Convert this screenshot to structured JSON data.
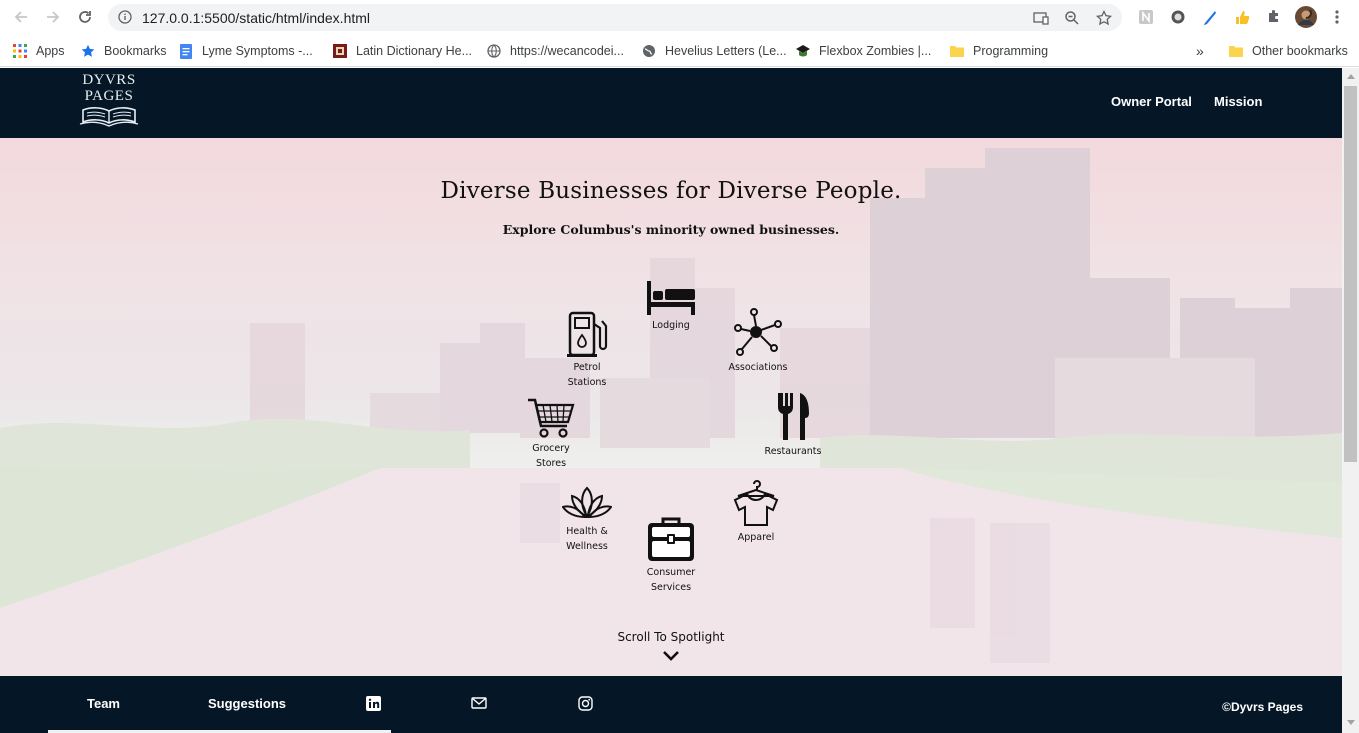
{
  "browser": {
    "url": "127.0.0.1:5500/static/html/index.html",
    "bookmarks": [
      {
        "label": "Apps",
        "icon": "apps-grid-icon"
      },
      {
        "label": "Bookmarks",
        "icon": "star-icon"
      },
      {
        "label": "Lyme Symptoms -...",
        "icon": "docs-icon"
      },
      {
        "label": "Latin Dictionary He...",
        "icon": "latin-dict-icon"
      },
      {
        "label": "https://wecancodei...",
        "icon": "globe-icon"
      },
      {
        "label": "Hevelius Letters (Le...",
        "icon": "globe-icon"
      },
      {
        "label": "Flexbox Zombies |...",
        "icon": "zombie-icon"
      },
      {
        "label": "Programming",
        "icon": "folder-icon"
      },
      {
        "label": "Other bookmarks",
        "icon": "folder-icon"
      }
    ],
    "overflow_label": "»"
  },
  "site": {
    "logo_line1": "DYVRS",
    "logo_line2": "PAGES",
    "nav": [
      "Owner Portal",
      "Mission"
    ],
    "hero_title": "Diverse Businesses for Diverse People.",
    "hero_subtitle": "Explore Columbus's minority owned businesses.",
    "categories": [
      {
        "line1": "Lodging",
        "line2": "",
        "icon": "bed-icon"
      },
      {
        "line1": "Petrol",
        "line2": "Stations",
        "icon": "fuel-pump-icon"
      },
      {
        "line1": "Associations",
        "line2": "",
        "icon": "network-icon"
      },
      {
        "line1": "Grocery",
        "line2": "Stores",
        "icon": "shopping-cart-icon"
      },
      {
        "line1": "Restaurants",
        "line2": "",
        "icon": "fork-knife-icon"
      },
      {
        "line1": "Health &",
        "line2": "Wellness",
        "icon": "lotus-icon"
      },
      {
        "line1": "Apparel",
        "line2": "",
        "icon": "shirt-icon"
      },
      {
        "line1": "Consumer",
        "line2": "Services",
        "icon": "briefcase-icon"
      }
    ],
    "scroll_label": "Scroll To Spotlight",
    "footer_links": [
      "Team",
      "Suggestions"
    ],
    "footer_icons": [
      "linkedin-icon",
      "mail-icon",
      "instagram-icon"
    ],
    "copyright": "©Dyvrs Pages"
  },
  "colors": {
    "header_bg": "#051726",
    "footer_bg": "#051726",
    "hero_tint": "#f0e3e6"
  }
}
